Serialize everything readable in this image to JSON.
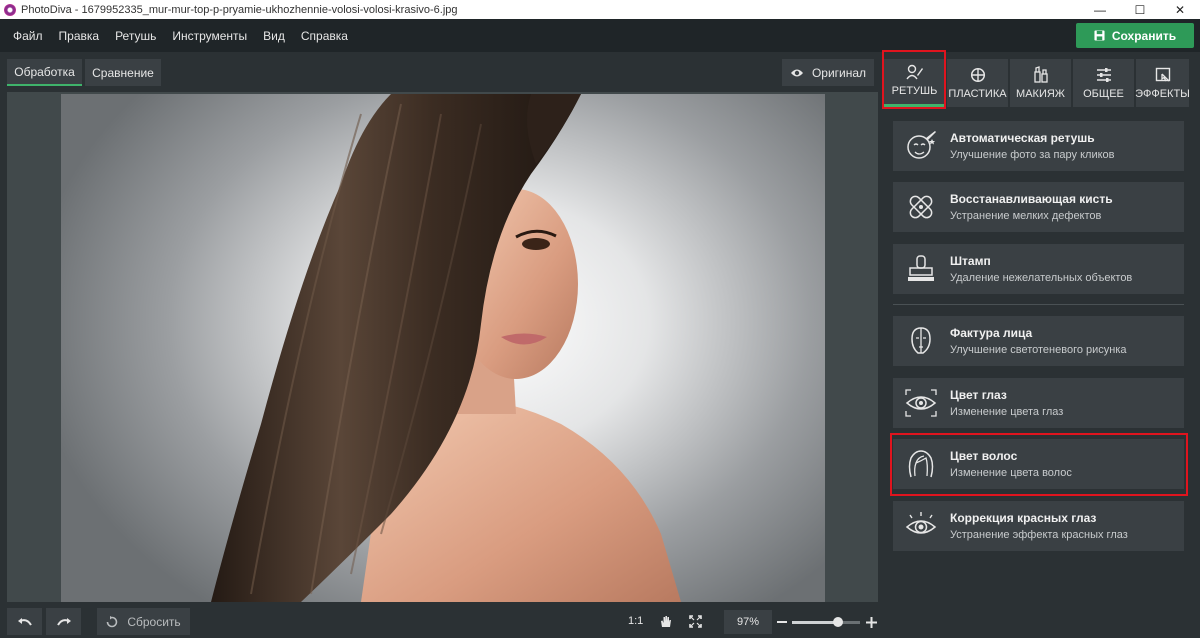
{
  "window": {
    "title": "PhotoDiva - 1679952335_mur-mur-top-p-pryamie-ukhozhennie-volosi-volosi-krasivo-6.jpg",
    "minimize": "—",
    "maximize": "☐",
    "close": "✕"
  },
  "menu": {
    "items": [
      "Файл",
      "Правка",
      "Ретушь",
      "Инструменты",
      "Вид",
      "Справка"
    ],
    "save_label": "Сохранить"
  },
  "view_tabs": {
    "processing": "Обработка",
    "compare": "Сравнение",
    "original": "Оригинал"
  },
  "bottom_bar": {
    "reset": "Сбросить",
    "one_to_one": "1:1",
    "zoom": "97%",
    "zoom_level": 0.68
  },
  "categories": [
    {
      "label": "РЕТУШЬ",
      "icon": "retouch-icon",
      "active": true
    },
    {
      "label": "ПЛАСТИКА",
      "icon": "plastic-icon",
      "active": false
    },
    {
      "label": "МАКИЯЖ",
      "icon": "makeup-icon",
      "active": false
    },
    {
      "label": "ОБЩЕЕ",
      "icon": "sliders-icon",
      "active": false
    },
    {
      "label": "ЭФФЕКТЫ",
      "icon": "effects-icon",
      "active": false
    }
  ],
  "tools": [
    {
      "name": "Автоматическая ретушь",
      "desc": "Улучшение фото за пару кликов",
      "icon": "auto-retouch-icon"
    },
    {
      "name": "Восстанавливающая кисть",
      "desc": "Устранение мелких дефектов",
      "icon": "bandage-icon"
    },
    {
      "name": "Штамп",
      "desc": "Удаление нежелательных объектов",
      "icon": "stamp-icon"
    },
    {
      "name": "Фактура лица",
      "desc": "Улучшение светотеневого рисунка",
      "icon": "face-texture-icon"
    },
    {
      "name": "Цвет глаз",
      "desc": "Изменение цвета глаз",
      "icon": "eye-color-icon"
    },
    {
      "name": "Цвет волос",
      "desc": "Изменение цвета волос",
      "icon": "hair-color-icon"
    },
    {
      "name": "Коррекция красных глаз",
      "desc": "Устранение эффекта красных глаз",
      "icon": "red-eye-icon"
    }
  ],
  "colors": {
    "accent_green": "#2e9a58",
    "highlight_red": "#e0141e",
    "panel_bg": "#2b3134",
    "card_bg": "#3a4044"
  }
}
